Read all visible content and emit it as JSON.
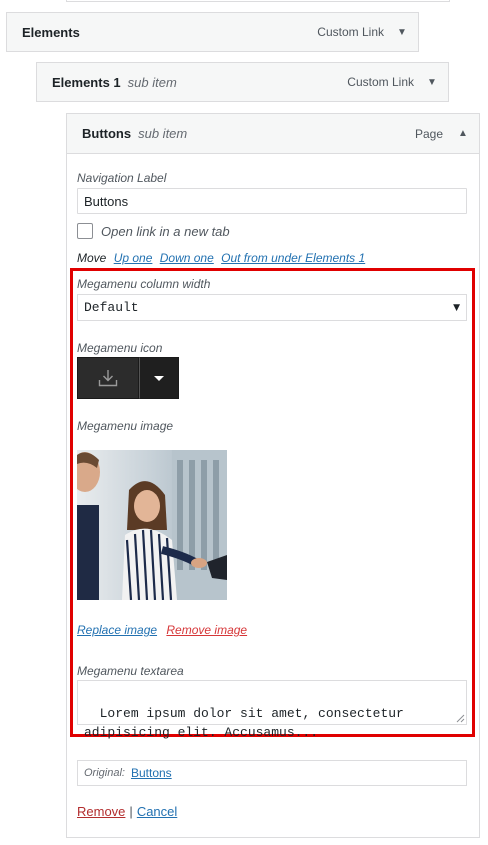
{
  "menu_items": [
    {
      "title": "Elements",
      "sub": "",
      "type": "Custom Link"
    },
    {
      "title": "Elements 1",
      "sub": "sub item",
      "type": "Custom Link"
    },
    {
      "title": "Buttons",
      "sub": "sub item",
      "type": "Page"
    }
  ],
  "settings": {
    "nav_label": "Navigation Label",
    "nav_value": "Buttons",
    "new_tab_label": "Open link in a new tab",
    "move_label": "Move",
    "move_links": [
      "Up one",
      "Down one",
      "Out from under Elements 1"
    ]
  },
  "megamenu": {
    "width_label": "Megamenu column width",
    "width_value": "Default",
    "icon_label": "Megamenu icon",
    "icon_name": "download-icon",
    "image_label": "Megamenu image",
    "replace_image": "Replace image",
    "remove_image": "Remove image",
    "textarea_label": "Megamenu textarea",
    "textarea_value": "Lorem ipsum dolor sit amet, consectetur\nadipisicing elit. Accusamus..."
  },
  "original": {
    "label": "Original:",
    "link": "Buttons"
  },
  "actions": {
    "remove": "Remove",
    "separator": "|",
    "cancel": "Cancel"
  },
  "colors": {
    "highlight": "#e00000",
    "link": "#2271b1",
    "danger": "#d63638"
  }
}
